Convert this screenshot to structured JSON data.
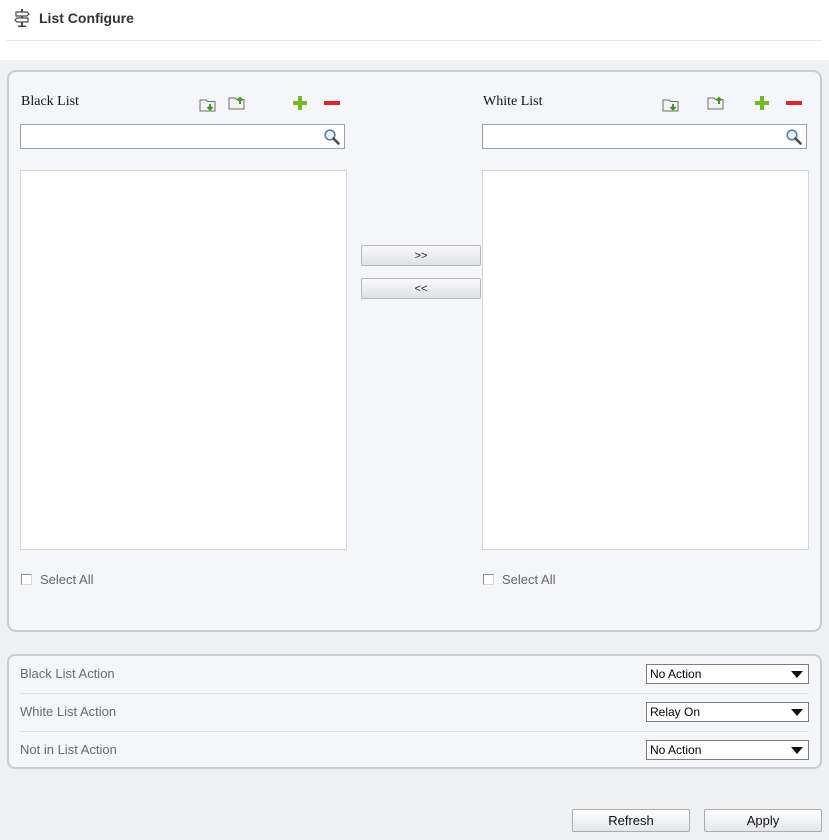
{
  "header": {
    "title": "List Configure",
    "icon": "signpost-icon"
  },
  "black_list": {
    "title": "Black List",
    "search": {
      "value": "",
      "placeholder": ""
    },
    "items": [],
    "select_all_label": "Select All",
    "tools": [
      "import-icon",
      "export-icon",
      "add-icon",
      "remove-icon"
    ]
  },
  "white_list": {
    "title": "White List",
    "search": {
      "value": "",
      "placeholder": ""
    },
    "items": [],
    "select_all_label": "Select All",
    "tools": [
      "import-icon",
      "export-icon",
      "add-icon",
      "remove-icon"
    ]
  },
  "transfer": {
    "move_right_label": ">>",
    "move_left_label": "<<"
  },
  "actions": [
    {
      "label": "Black List Action",
      "selected": "No Action"
    },
    {
      "label": "White List Action",
      "selected": "Relay On"
    },
    {
      "label": "Not in List Action",
      "selected": "No Action"
    }
  ],
  "footer": {
    "refresh_label": "Refresh",
    "apply_label": "Apply"
  },
  "colors": {
    "panel_border": "#c7cbd2",
    "panel_bg": "#f4f6f9",
    "page_bg": "#eff0f2",
    "add_green": "#77b82a",
    "remove_red": "#e02525"
  }
}
